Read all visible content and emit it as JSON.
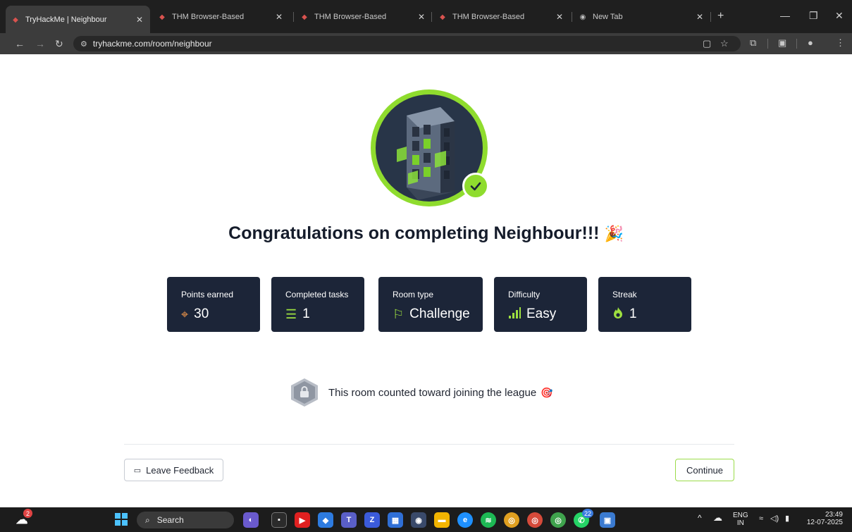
{
  "browser": {
    "tabs": [
      {
        "title": "TryHackMe | Neighbour",
        "active": true
      },
      {
        "title": "THM Browser-Based",
        "active": false
      },
      {
        "title": "THM Browser-Based",
        "active": false
      },
      {
        "title": "THM Browser-Based",
        "active": false
      },
      {
        "title": "New Tab",
        "active": false
      }
    ],
    "url": "tryhackme.com/room/neighbour"
  },
  "completion": {
    "title": "Congratulations on completing Neighbour!!!",
    "title_emoji": "🎉",
    "stats": [
      {
        "label": "Points earned",
        "value": "30",
        "icon": "crosshair-icon",
        "icon_color": "#e8924a"
      },
      {
        "label": "Completed tasks",
        "value": "1",
        "icon": "task-list-icon",
        "icon_color": "#9ee040"
      },
      {
        "label": "Room type",
        "value": "Challenge",
        "icon": "flag-icon",
        "icon_color": "#9ee040"
      },
      {
        "label": "Difficulty",
        "value": "Easy",
        "icon": "signal-bars-icon",
        "icon_color": "#9ee040"
      },
      {
        "label": "Streak",
        "value": "1",
        "icon": "flame-icon",
        "icon_color": "#9ee040"
      }
    ],
    "league_text": "This room counted toward joining the league",
    "league_emoji": "🎯",
    "feedback_label": "Leave Feedback",
    "continue_label": "Continue"
  },
  "taskbar": {
    "search_label": "Search",
    "weather_badge": "2",
    "whatsapp_badge": "22",
    "language": "ENG",
    "region": "IN",
    "time": "23:49",
    "date": "12-07-2025"
  },
  "colors": {
    "accent_green": "#8fdc2e",
    "card_bg": "#1c2538",
    "tab_bar": "#1f1f1f"
  }
}
